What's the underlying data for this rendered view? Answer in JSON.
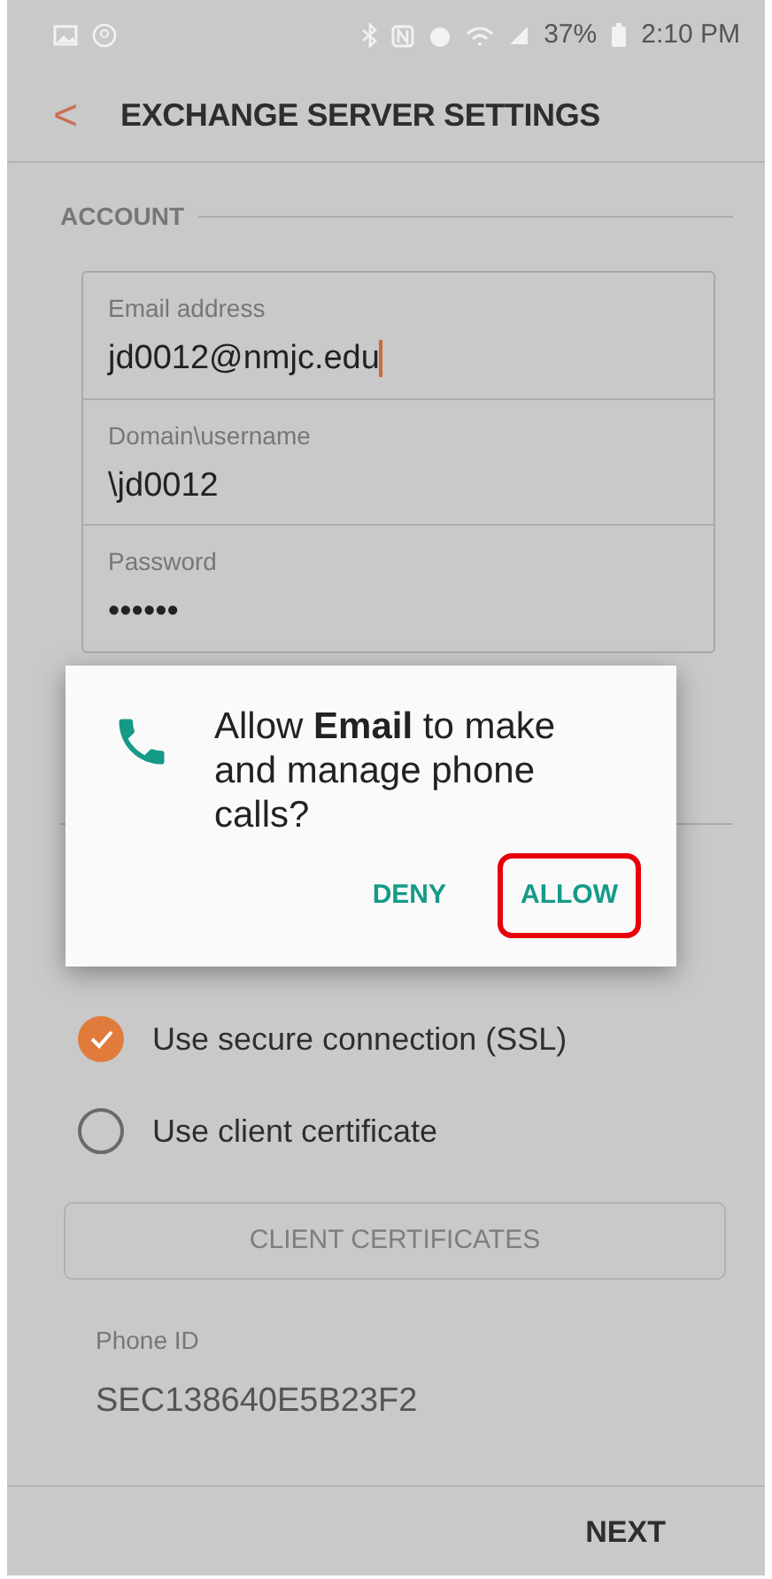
{
  "status_bar": {
    "battery": "37%",
    "time": "2:10 PM"
  },
  "header": {
    "back": "<",
    "title": "EXCHANGE SERVER SETTINGS"
  },
  "account": {
    "heading": "ACCOUNT",
    "fields": [
      {
        "label": "Email address",
        "value": "jd0012@nmjc.edu",
        "focused": true
      },
      {
        "label": "Domain\\username",
        "value": "\\jd0012",
        "focused": false
      },
      {
        "label": "Password",
        "value": "••••••",
        "focused": false
      }
    ]
  },
  "options": [
    {
      "label": "Use secure connection (SSL)",
      "checked": true
    },
    {
      "label": "Use client certificate",
      "checked": false
    }
  ],
  "client_certificates_button": {
    "label": "CLIENT CERTIFICATES",
    "disabled": true
  },
  "phone_id": {
    "label": "Phone ID",
    "value": "SEC138640E5B23F2"
  },
  "footer": {
    "next": "NEXT"
  },
  "dialog": {
    "message": "Allow **Email** to make and manage phone calls?",
    "buttons": [
      {
        "label": "DENY",
        "highlighted": false
      },
      {
        "label": "ALLOW",
        "highlighted": true
      }
    ]
  }
}
